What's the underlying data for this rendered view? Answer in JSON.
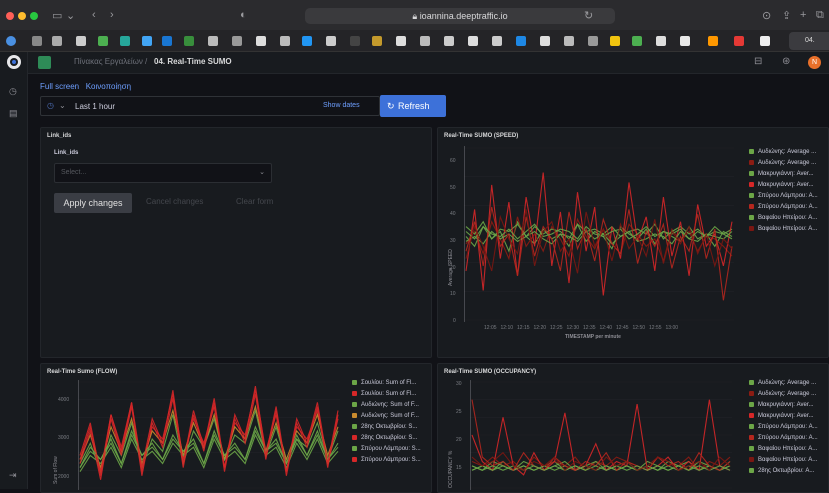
{
  "browser": {
    "url": "ioannina.deeptraffic.io",
    "active_tab_label": "04. Real..."
  },
  "header": {
    "breadcrumb_root": "Πίνακας Εργαλείων",
    "breadcrumb_sep": "/",
    "dashboard_title": "04. Real-Time SUMO",
    "links": [
      "Full screen",
      "Κοινοποίηση"
    ],
    "time_range": "Last 1 hour",
    "show_dates": "Show dates",
    "refresh_label": "Refresh",
    "avatar_initials": "N"
  },
  "filter_panel": {
    "title": "Link_ids",
    "field_label": "Link_ids",
    "select_placeholder": "Select...",
    "apply": "Apply changes",
    "cancel": "Cancel changes",
    "clear": "Clear form"
  },
  "colors": {
    "green": "#6ca647",
    "red": "#d62728",
    "dark_red": "#8c1c13",
    "orange": "#c98b2e",
    "accent": "#3d71d9"
  },
  "chart_data": [
    {
      "type": "line",
      "title": "Real-Time SUMO (SPEED)",
      "ylabel": "Average SPEED",
      "xlabel": "TIMESTAMP per minute",
      "y_ticks": [
        "60",
        "50",
        "40",
        "30",
        "20",
        "10",
        "0"
      ],
      "ylim": [
        0,
        70
      ],
      "categories": [
        "12:05",
        "12:10",
        "12:15",
        "12:20",
        "12:25",
        "12:30",
        "12:35",
        "12:40",
        "12:45",
        "12:50",
        "12:55",
        "13:00"
      ],
      "legend_position": "right",
      "series": [
        {
          "name": "Αυδιώνης: Average ...",
          "color": "#6ca647",
          "values": [
            34,
            30,
            38,
            33,
            36,
            28,
            40,
            34,
            31,
            37,
            33,
            35,
            30,
            39,
            32,
            36,
            34,
            29,
            38,
            35,
            33,
            37,
            31,
            36,
            34,
            32,
            38,
            33,
            35,
            30,
            36,
            34
          ]
        },
        {
          "name": "Αυδιώνης: Average ...",
          "color": "#8c1c13",
          "values": [
            31,
            36,
            27,
            40,
            33,
            25,
            42,
            30,
            35,
            28,
            38,
            33,
            26,
            41,
            34,
            29,
            37,
            31,
            27,
            39,
            35,
            30,
            33,
            24,
            37,
            32,
            36,
            28,
            34,
            33,
            30,
            26
          ]
        },
        {
          "name": "Μακρυγιάννη: Aver...",
          "color": "#6ca647",
          "values": [
            38,
            35,
            40,
            33,
            37,
            36,
            39,
            34,
            38,
            35,
            37,
            36,
            33,
            39,
            36,
            37,
            35,
            38,
            34,
            36,
            37,
            35,
            39,
            33,
            36,
            38,
            35,
            37,
            34,
            36,
            35,
            37
          ]
        },
        {
          "name": "Μακρυγιάννη: Aver...",
          "color": "#d62728",
          "values": [
            20,
            45,
            12,
            55,
            25,
            48,
            18,
            50,
            30,
            60,
            22,
            44,
            15,
            52,
            28,
            46,
            10,
            38,
            25,
            56,
            32,
            42,
            20,
            50,
            26,
            40,
            18,
            47,
            30,
            35,
            22,
            40
          ]
        },
        {
          "name": "Σπύρου Λάμπρου: A...",
          "color": "#6ca647",
          "values": [
            32,
            34,
            31,
            36,
            33,
            35,
            32,
            34,
            36,
            33,
            31,
            35,
            34,
            32,
            36,
            33,
            35,
            31,
            34,
            36,
            32,
            33,
            35,
            34,
            31,
            36,
            33,
            32,
            35,
            34,
            33,
            36
          ]
        },
        {
          "name": "Σπύρου Λάμπρου: A...",
          "color": "#b5271e",
          "values": [
            28,
            40,
            22,
            46,
            30,
            35,
            18,
            42,
            26,
            38,
            33,
            20,
            44,
            29,
            37,
            24,
            41,
            31,
            27,
            45,
            23,
            36,
            30,
            39,
            21,
            34,
            28,
            43,
            25,
            37,
            8,
            30
          ]
        },
        {
          "name": "Βαφαίου Ηπείρου: A...",
          "color": "#6ca647",
          "values": [
            36,
            33,
            38,
            35,
            34,
            37,
            33,
            36,
            39,
            34,
            35,
            37,
            36,
            33,
            38,
            35,
            34,
            36,
            37,
            33,
            35,
            38,
            34,
            36,
            35,
            37,
            33,
            36,
            34,
            38,
            35,
            33
          ]
        },
        {
          "name": "Βαφαίου Ηπείρου: A...",
          "color": "#7a1712",
          "values": [
            25,
            38,
            30,
            20,
            42,
            33,
            27,
            45,
            22,
            36,
            40,
            28,
            33,
            19,
            44,
            30,
            37,
            24,
            39,
            29,
            34,
            26,
            41,
            23,
            36,
            31,
            38,
            27,
            35,
            22,
            33,
            29
          ]
        }
      ]
    },
    {
      "type": "line",
      "title": "Real-Time Sumo (FLOW)",
      "ylabel": "Sum of Flow",
      "y_ticks": [
        "4000",
        "3000",
        "2000"
      ],
      "legend_position": "right",
      "series": [
        {
          "name": "Σουλίου: Sum of Fl...",
          "color": "#6ca647",
          "values": [
            2400,
            2900,
            2200,
            3100,
            2600,
            3400,
            2300,
            3000,
            2700,
            3600,
            2400,
            3200,
            2800,
            3500,
            2500,
            3100,
            2900,
            3700,
            2600,
            3300,
            2400,
            3000,
            2800,
            3400,
            2500,
            3200
          ]
        },
        {
          "name": "Σουλίου: Sum of Fl...",
          "color": "#d62728",
          "values": [
            2600,
            3400,
            2100,
            3600,
            2800,
            3900,
            2200,
            3300,
            3000,
            4100,
            2500,
            3500,
            2900,
            3800,
            2300,
            3400,
            3100,
            4200,
            2700,
            3600,
            2200,
            3300,
            3000,
            3700,
            2400,
            3500
          ]
        },
        {
          "name": "Αυδιώνης: Sum of F...",
          "color": "#6ca647",
          "values": [
            2300,
            2700,
            2500,
            2900,
            2400,
            3100,
            2600,
            2800,
            2500,
            3000,
            2700,
            2900,
            2400,
            3100,
            2600,
            2800,
            2500,
            3200,
            2700,
            2900,
            2400,
            3000,
            2600,
            3100,
            2500,
            2800
          ]
        },
        {
          "name": "Αυδιώνης: Sum of F...",
          "color": "#c98b2e",
          "values": [
            2500,
            3100,
            2300,
            3300,
            2700,
            3500,
            2400,
            3200,
            2900,
            3700,
            2600,
            3400,
            2800,
            3600,
            2500,
            3300,
            3000,
            3800,
            2700,
            3400,
            2500,
            3200,
            2900,
            3600,
            2600,
            3300
          ]
        },
        {
          "name": "28ης Οκτωβρίου: S...",
          "color": "#6ca647",
          "values": [
            2200,
            2600,
            2400,
            2800,
            2300,
            3000,
            2500,
            2700,
            2400,
            2900,
            2600,
            2800,
            2300,
            3000,
            2500,
            2700,
            2400,
            3100,
            2600,
            2800,
            2300,
            2900,
            2500,
            3000,
            2400,
            2700
          ]
        },
        {
          "name": "28ης Οκτωβρίου: S...",
          "color": "#d62728",
          "values": [
            2400,
            3200,
            2000,
            3500,
            2600,
            3800,
            2100,
            3400,
            2800,
            4000,
            2300,
            3600,
            2700,
            3900,
            2200,
            3500,
            2900,
            4100,
            2500,
            3700,
            2100,
            3400,
            2800,
            3800,
            2300,
            3600
          ]
        },
        {
          "name": "Σπύρου Λάμπρου: S...",
          "color": "#6ca647",
          "values": [
            2300,
            2800,
            2500,
            3000,
            2400,
            3200,
            2600,
            2900,
            2500,
            3100,
            2700,
            3000,
            2400,
            3200,
            2600,
            2900,
            2500,
            3300,
            2700,
            3000,
            2400,
            3100,
            2600,
            3200,
            2500,
            2900
          ]
        },
        {
          "name": "Σπύρου Λάμπρου: S...",
          "color": "#d62728",
          "values": [
            2500,
            3300,
            2200,
            3600,
            2700,
            3900,
            2300,
            3500,
            2900,
            4200,
            2400,
            3700,
            2800,
            4000,
            2300,
            3600,
            3000,
            4300,
            2600,
            3800,
            2200,
            3500,
            2900,
            3900,
            2400,
            3700
          ]
        }
      ]
    },
    {
      "type": "line",
      "title": "Real-Time SUMO (OCCUPANCY)",
      "ylabel": "OCCUPANCY %",
      "y_ticks": [
        "30",
        "25",
        "20",
        "15"
      ],
      "legend_position": "right",
      "series": [
        {
          "name": "Αυδιώνης: Average ...",
          "color": "#6ca647",
          "values": [
            12,
            13,
            12,
            14,
            12,
            13,
            12,
            13,
            14,
            12,
            13,
            12,
            14,
            13,
            12,
            13,
            12,
            14,
            13,
            12,
            13,
            14,
            12,
            13,
            12,
            13
          ]
        },
        {
          "name": "Αυδιώνης: Average ...",
          "color": "#8c1c13",
          "values": [
            14,
            13,
            15,
            13,
            14,
            12,
            15,
            13,
            14,
            13,
            15,
            12,
            14,
            13,
            15,
            14,
            13,
            12,
            15,
            14,
            13,
            15,
            12,
            14,
            13,
            15
          ]
        },
        {
          "name": "Μακρυγιάννη: Aver...",
          "color": "#6ca647",
          "values": [
            13,
            12,
            14,
            13,
            12,
            14,
            13,
            12,
            13,
            14,
            12,
            13,
            14,
            12,
            13,
            14,
            12,
            13,
            12,
            14,
            13,
            12,
            14,
            13,
            12,
            14
          ]
        },
        {
          "name": "Μακρυγιάννη: Aver...",
          "color": "#d62728",
          "values": [
            20,
            14,
            12,
            24,
            13,
            11,
            16,
            12,
            14,
            25,
            12,
            13,
            18,
            12,
            14,
            13,
            27,
            12,
            13,
            15,
            12,
            14,
            12,
            28,
            13,
            12
          ]
        },
        {
          "name": "Σπύρου Λάμπρου: A...",
          "color": "#6ca647",
          "values": [
            12,
            13,
            12,
            13,
            12,
            13,
            12,
            13,
            12,
            13,
            12,
            13,
            12,
            13,
            12,
            13,
            12,
            13,
            12,
            13,
            12,
            13,
            12,
            13,
            12,
            13
          ]
        },
        {
          "name": "Σπύρου Λάμπρου: A...",
          "color": "#b5271e",
          "values": [
            28,
            15,
            13,
            14,
            12,
            16,
            13,
            12,
            15,
            13,
            12,
            14,
            13,
            16,
            12,
            14,
            13,
            12,
            15,
            13,
            14,
            12,
            16,
            13,
            12,
            14
          ]
        },
        {
          "name": "Βαφαίου Ηπείρου: A...",
          "color": "#6ca647",
          "values": [
            13,
            12,
            13,
            12,
            13,
            12,
            13,
            12,
            13,
            12,
            13,
            12,
            13,
            12,
            13,
            12,
            13,
            12,
            13,
            12,
            13,
            12,
            13,
            12,
            13,
            12
          ]
        },
        {
          "name": "Βαφαίου Ηπείρου: A...",
          "color": "#7a1712",
          "values": [
            15,
            13,
            14,
            16,
            13,
            12,
            14,
            13,
            15,
            12,
            14,
            13,
            12,
            15,
            13,
            14,
            12,
            13,
            15,
            14,
            12,
            13,
            14,
            12,
            15,
            13
          ]
        },
        {
          "name": "28ης Οκτωβρίου: A...",
          "color": "#6ca647",
          "values": []
        }
      ]
    }
  ]
}
